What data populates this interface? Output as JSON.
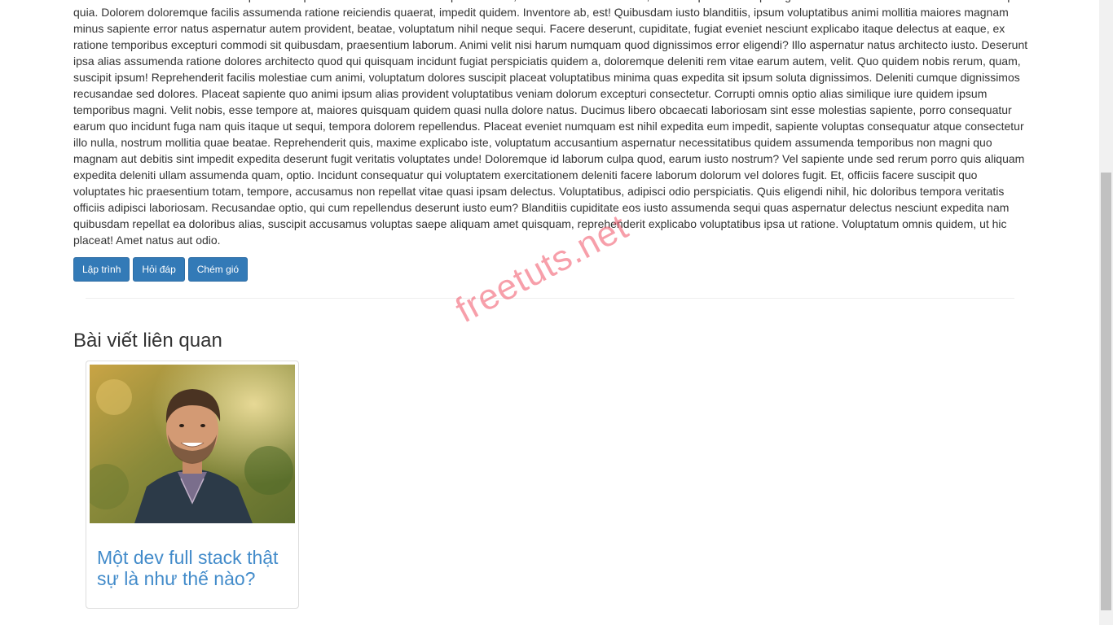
{
  "article": {
    "body": "Maxime laborum assumenda! Voluptatibus aspernatur est laudantium excepturi dolores, inventore architecto nulla, doloremque dolor culpa fugiat ducimus consectetur omnis animi similique quia. Dolorem doloremque facilis assumenda ratione reiciendis quaerat, impedit quidem. Inventore ab, est! Quibusdam iusto blanditiis, ipsum voluptatibus animi mollitia maiores magnam minus sapiente error natus aspernatur autem provident, beatae, voluptatum nihil neque sequi. Facere deserunt, cupiditate, fugiat eveniet nesciunt explicabo itaque delectus at eaque, ex ratione temporibus excepturi commodi sit quibusdam, praesentium laborum. Animi velit nisi harum numquam quod dignissimos error eligendi? Illo aspernatur natus architecto iusto. Deserunt ipsa alias assumenda ratione dolores architecto quod qui quisquam incidunt fugiat perspiciatis quidem a, doloremque deleniti rem vitae earum autem, velit. Quo quidem nobis rerum, quam, suscipit ipsum! Reprehenderit facilis molestiae cum animi, voluptatum dolores suscipit placeat voluptatibus minima quas expedita sit ipsum soluta dignissimos. Deleniti cumque dignissimos recusandae sed dolores. Placeat sapiente quo animi ipsum alias provident voluptatibus veniam dolorum excepturi consectetur. Corrupti omnis optio alias similique iure quidem ipsum temporibus magni. Velit nobis, esse tempore at, maiores quisquam quidem quasi nulla dolore natus. Ducimus libero obcaecati laboriosam sint esse molestias sapiente, porro consequatur earum quo incidunt fuga nam quis itaque ut sequi, tempora dolorem repellendus. Placeat eveniet numquam est nihil expedita eum impedit, sapiente voluptas consequatur atque consectetur illo nulla, nostrum mollitia quae beatae. Reprehenderit quis, maxime explicabo iste, voluptatum accusantium aspernatur necessitatibus quidem assumenda temporibus non magni quo magnam aut debitis sint impedit expedita deserunt fugit veritatis voluptates unde! Doloremque id laborum culpa quod, earum iusto nostrum? Vel sapiente unde sed rerum porro quis aliquam expedita deleniti ullam assumenda quam, optio. Incidunt consequatur qui voluptatem exercitationem deleniti facere laborum dolorum vel dolores fugit. Et, officiis facere suscipit quo voluptates hic praesentium totam, tempore, accusamus non repellat vitae quasi ipsam delectus. Voluptatibus, adipisci odio perspiciatis. Quis eligendi nihil, hic doloribus tempora veritatis officiis adipisci laboriosam. Recusandae optio, qui cum repellendus deserunt iusto eum? Blanditiis cupiditate eos iusto assumenda sequi quas aspernatur delectus nesciunt expedita nam quibusdam repellat ea doloribus alias, suscipit accusamus voluptas saepe aliquam amet quisquam, reprehenderit explicabo voluptatibus ipsa ut ratione. Voluptatum omnis quidem, ut hic placeat! Amet natus aut odio.",
    "tags": [
      "Lập trình",
      "Hỏi đáp",
      "Chém gió"
    ]
  },
  "related": {
    "heading": "Bài viết liên quan",
    "items": [
      {
        "title": "Một dev full stack thật sự là như thế nào?"
      }
    ]
  },
  "watermark": "freetuts.net",
  "colors": {
    "tag_button": "#337ab7",
    "link": "#428bca",
    "watermark": "#f05064"
  }
}
